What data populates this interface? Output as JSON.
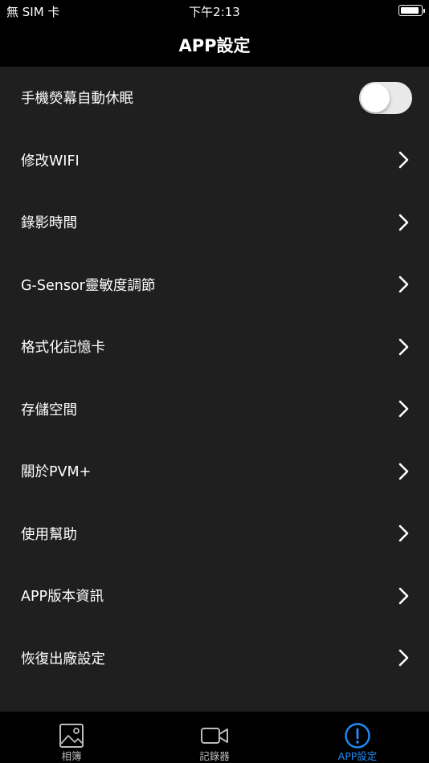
{
  "status_bar": {
    "carrier": "無 SIM 卡",
    "time": "下午2:13"
  },
  "header": {
    "title": "APP設定"
  },
  "settings": {
    "items": [
      {
        "label": "手機熒幕自動休眠",
        "control": "toggle",
        "toggle_on": false
      },
      {
        "label": "修改WIFI",
        "control": "chevron"
      },
      {
        "label": "錄影時間",
        "control": "chevron"
      },
      {
        "label": "G-Sensor靈敏度調節",
        "control": "chevron"
      },
      {
        "label": "格式化記憶卡",
        "control": "chevron"
      },
      {
        "label": "存儲空間",
        "control": "chevron"
      },
      {
        "label": "關於PVM+",
        "control": "chevron"
      },
      {
        "label": "使用幫助",
        "control": "chevron"
      },
      {
        "label": "APP版本資訊",
        "control": "chevron"
      },
      {
        "label": "恢復出廠設定",
        "control": "chevron"
      }
    ]
  },
  "tabs": [
    {
      "label": "相簿",
      "icon": "photo-icon",
      "active": false
    },
    {
      "label": "記錄器",
      "icon": "video-camera-icon",
      "active": false
    },
    {
      "label": "APP設定",
      "icon": "info-circle-icon",
      "active": true
    }
  ],
  "colors": {
    "accent": "#1e8cf5",
    "background": "#1f1f1f",
    "bar": "#000000"
  }
}
